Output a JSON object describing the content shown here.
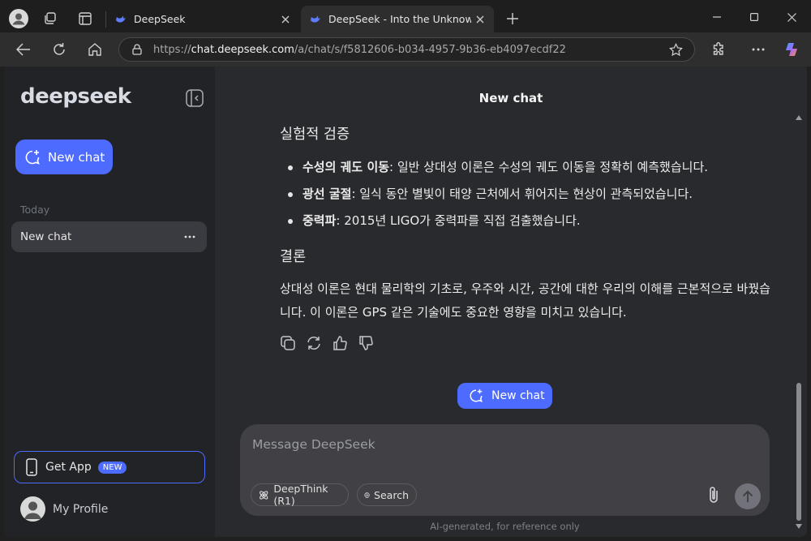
{
  "browser": {
    "tabs": [
      {
        "title": "DeepSeek",
        "active": false
      },
      {
        "title": "DeepSeek - Into the Unknown",
        "active": true
      }
    ],
    "url_prefix": "https://",
    "url_host": "chat.deepseek.com",
    "url_path": "/a/chat/s/f5812606-b034-4957-9b36-eb4097ecdf22"
  },
  "sidebar": {
    "logo": "deepseek",
    "new_chat_label": "New chat",
    "section_label": "Today",
    "chats": [
      {
        "title": "New chat"
      }
    ],
    "get_app_label": "Get App",
    "get_app_badge": "NEW",
    "profile_label": "My Profile"
  },
  "main": {
    "title": "New chat",
    "heading1": "실험적 검증",
    "bullets": [
      {
        "term": "수성의 궤도 이동",
        "text": ": 일반 상대성 이론은 수성의 궤도 이동을 정확히 예측했습니다."
      },
      {
        "term": "광선 굴절",
        "text": ": 일식 동안 별빛이 태양 근처에서 휘어지는 현상이 관측되었습니다."
      },
      {
        "term": "중력파",
        "text": ": 2015년 LIGO가 중력파를 직접 검출했습니다."
      }
    ],
    "heading2": "결론",
    "paragraph": "상대성 이론은 현대 물리학의 기초로, 우주와 시간, 공간에 대한 우리의 이해를 근본적으로 바꿨습니다. 이 이론은 GPS 같은 기술에도 중요한 영향을 미치고 있습니다.",
    "new_chat_label": "New chat",
    "composer_placeholder": "Message DeepSeek",
    "deepthink_label": "DeepThink (R1)",
    "search_label": "Search",
    "disclaimer": "AI-generated, for reference only"
  },
  "colors": {
    "accent": "#4d6bfe",
    "sidebar_bg": "#212327",
    "main_bg": "#292a2d",
    "composer_bg": "#404045"
  }
}
